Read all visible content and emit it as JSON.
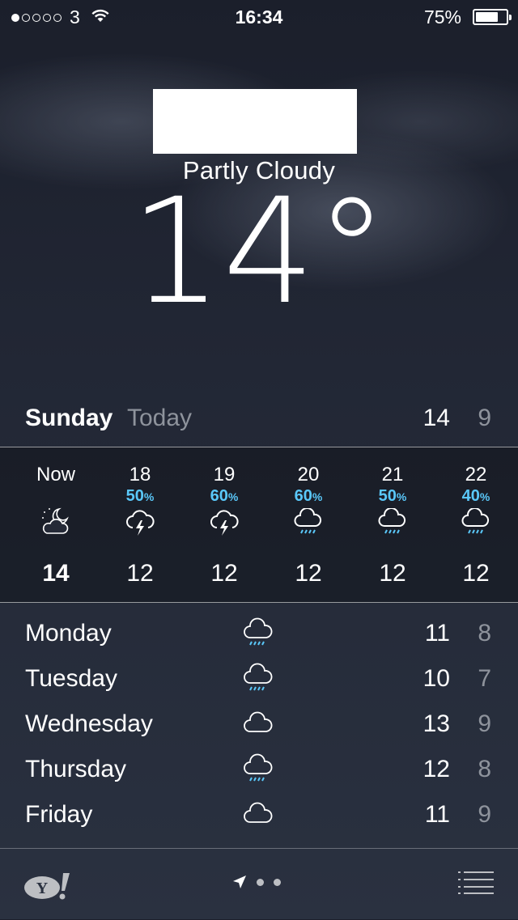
{
  "status_bar": {
    "carrier": "3",
    "time": "16:34",
    "battery_percent_label": "75%",
    "battery_level": 0.75
  },
  "current": {
    "condition": "Partly Cloudy",
    "temperature": "14°"
  },
  "today": {
    "day": "Sunday",
    "label": "Today",
    "high": "14",
    "low": "9"
  },
  "hourly": [
    {
      "time": "Now",
      "precip": "",
      "icon": "partly-cloudy-night-icon",
      "temp": "14"
    },
    {
      "time": "18",
      "precip": "50",
      "icon": "thunderstorm-icon",
      "temp": "12"
    },
    {
      "time": "19",
      "precip": "60",
      "icon": "thunderstorm-icon",
      "temp": "12"
    },
    {
      "time": "20",
      "precip": "60",
      "icon": "rain-icon",
      "temp": "12"
    },
    {
      "time": "21",
      "precip": "50",
      "icon": "rain-icon",
      "temp": "12"
    },
    {
      "time": "22",
      "precip": "40",
      "icon": "rain-icon",
      "temp": "12"
    }
  ],
  "precip_unit": "%",
  "daily": [
    {
      "day": "Monday",
      "icon": "rain-icon",
      "high": "11",
      "low": "8"
    },
    {
      "day": "Tuesday",
      "icon": "rain-icon",
      "high": "10",
      "low": "7"
    },
    {
      "day": "Wednesday",
      "icon": "cloud-icon",
      "high": "13",
      "low": "9"
    },
    {
      "day": "Thursday",
      "icon": "rain-icon",
      "high": "12",
      "low": "8"
    },
    {
      "day": "Friday",
      "icon": "cloud-icon",
      "high": "11",
      "low": "9"
    }
  ],
  "bottom_bar": {
    "left_icon": "yahoo-logo",
    "page_indicator": [
      "location-arrow-icon",
      "page-dot",
      "page-dot"
    ],
    "right_icon": "list-icon"
  },
  "colors": {
    "precip_blue": "#5ac8fa",
    "secondary_text": "#8e939c"
  }
}
